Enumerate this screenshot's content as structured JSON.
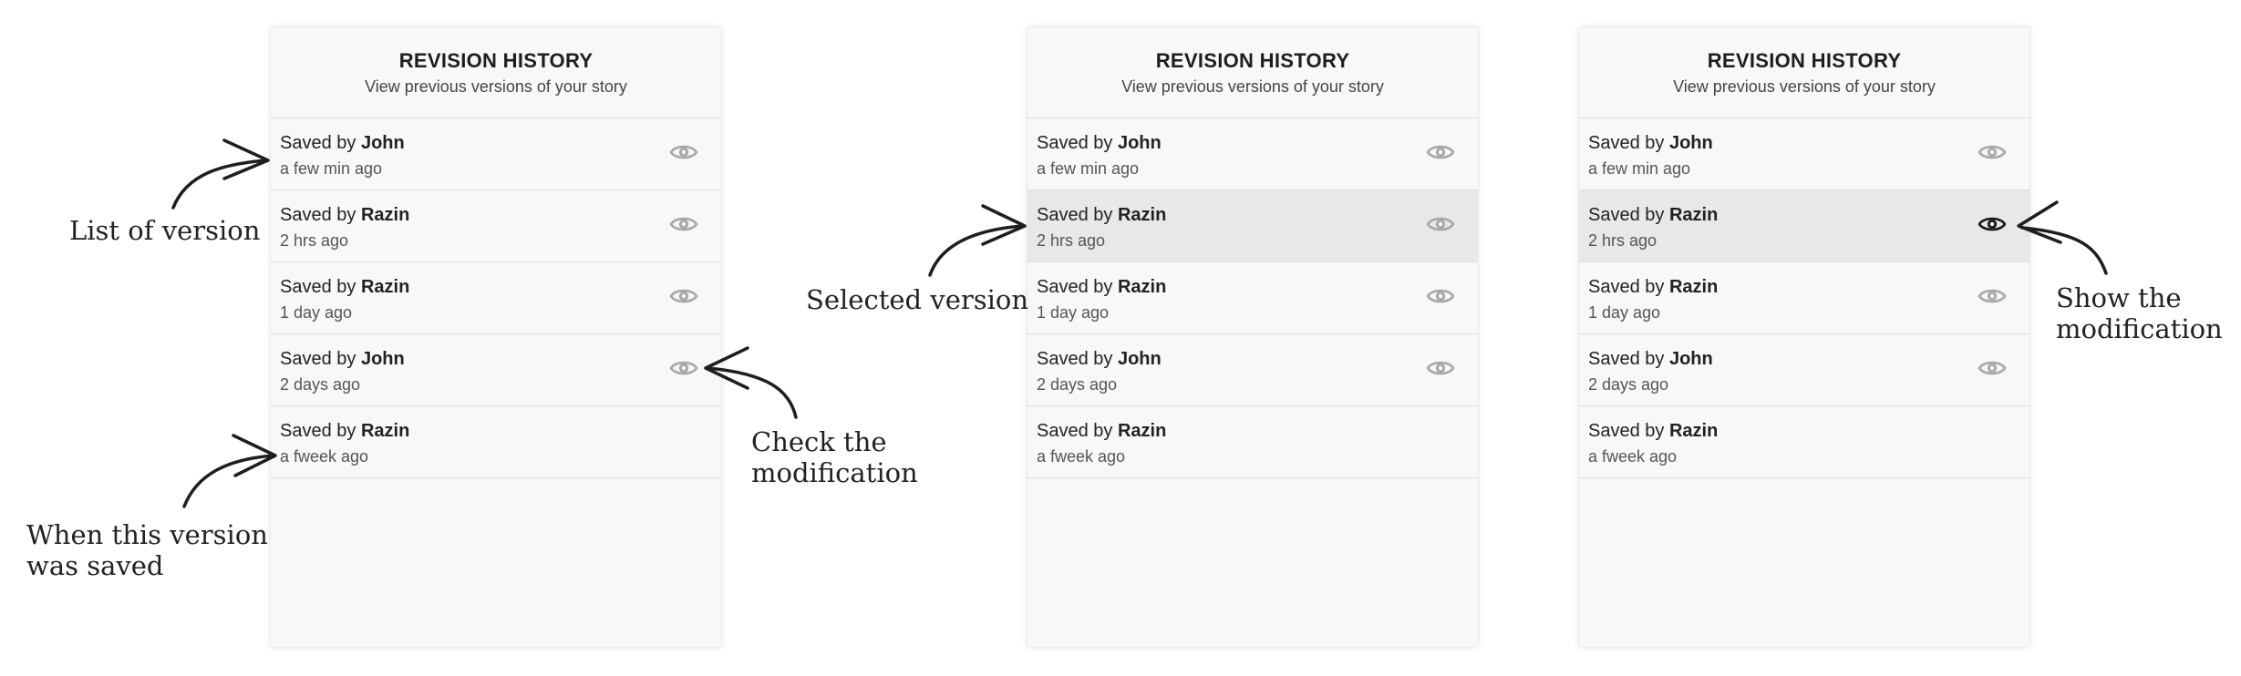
{
  "colors": {
    "eye_default": "#a8a8a8",
    "eye_active": "#1c1c1c",
    "selected_row": "#e8e8e8",
    "panel_bg": "#f8f8f8"
  },
  "icons": {
    "row_action": "eye-icon"
  },
  "panels": [
    {
      "title": "REVISION HISTORY",
      "subtitle": "View previous versions of your story",
      "items": [
        {
          "prefix": "Saved by ",
          "author": "John",
          "time": "a few min ago",
          "has_eye": true,
          "selected": false,
          "eye_active": false
        },
        {
          "prefix": "Saved by ",
          "author": "Razin",
          "time": "2 hrs ago",
          "has_eye": true,
          "selected": false,
          "eye_active": false
        },
        {
          "prefix": "Saved by ",
          "author": "Razin",
          "time": "1 day ago",
          "has_eye": true,
          "selected": false,
          "eye_active": false
        },
        {
          "prefix": "Saved by ",
          "author": "John",
          "time": "2 days ago",
          "has_eye": true,
          "selected": false,
          "eye_active": false
        },
        {
          "prefix": "Saved by ",
          "author": "Razin",
          "time": "a fweek ago",
          "has_eye": false,
          "selected": false,
          "eye_active": false
        }
      ]
    },
    {
      "title": "REVISION HISTORY",
      "subtitle": "View previous versions of your story",
      "items": [
        {
          "prefix": "Saved by ",
          "author": "John",
          "time": "a few min ago",
          "has_eye": true,
          "selected": false,
          "eye_active": false
        },
        {
          "prefix": "Saved by ",
          "author": "Razin",
          "time": "2 hrs ago",
          "has_eye": true,
          "selected": true,
          "eye_active": false
        },
        {
          "prefix": "Saved by ",
          "author": "Razin",
          "time": "1 day ago",
          "has_eye": true,
          "selected": false,
          "eye_active": false
        },
        {
          "prefix": "Saved by ",
          "author": "John",
          "time": "2 days ago",
          "has_eye": true,
          "selected": false,
          "eye_active": false
        },
        {
          "prefix": "Saved by ",
          "author": "Razin",
          "time": "a fweek ago",
          "has_eye": false,
          "selected": false,
          "eye_active": false
        }
      ]
    },
    {
      "title": "REVISION HISTORY",
      "subtitle": "View previous versions of your story",
      "items": [
        {
          "prefix": "Saved by ",
          "author": "John",
          "time": "a few min ago",
          "has_eye": true,
          "selected": false,
          "eye_active": false
        },
        {
          "prefix": "Saved by ",
          "author": "Razin",
          "time": "2 hrs ago",
          "has_eye": true,
          "selected": true,
          "eye_active": true
        },
        {
          "prefix": "Saved by ",
          "author": "Razin",
          "time": "1 day ago",
          "has_eye": true,
          "selected": false,
          "eye_active": false
        },
        {
          "prefix": "Saved by ",
          "author": "John",
          "time": "2 days ago",
          "has_eye": true,
          "selected": false,
          "eye_active": false
        },
        {
          "prefix": "Saved by ",
          "author": "Razin",
          "time": "a fweek ago",
          "has_eye": false,
          "selected": false,
          "eye_active": false
        }
      ]
    }
  ],
  "annotations": {
    "list_of_version": "List of version",
    "when_saved_line1": "When this version",
    "when_saved_line2": "was saved",
    "check_line1": "Check the",
    "check_line2": "modification",
    "selected_version": "Selected version",
    "show_line1": "Show the",
    "show_line2": "modification"
  }
}
